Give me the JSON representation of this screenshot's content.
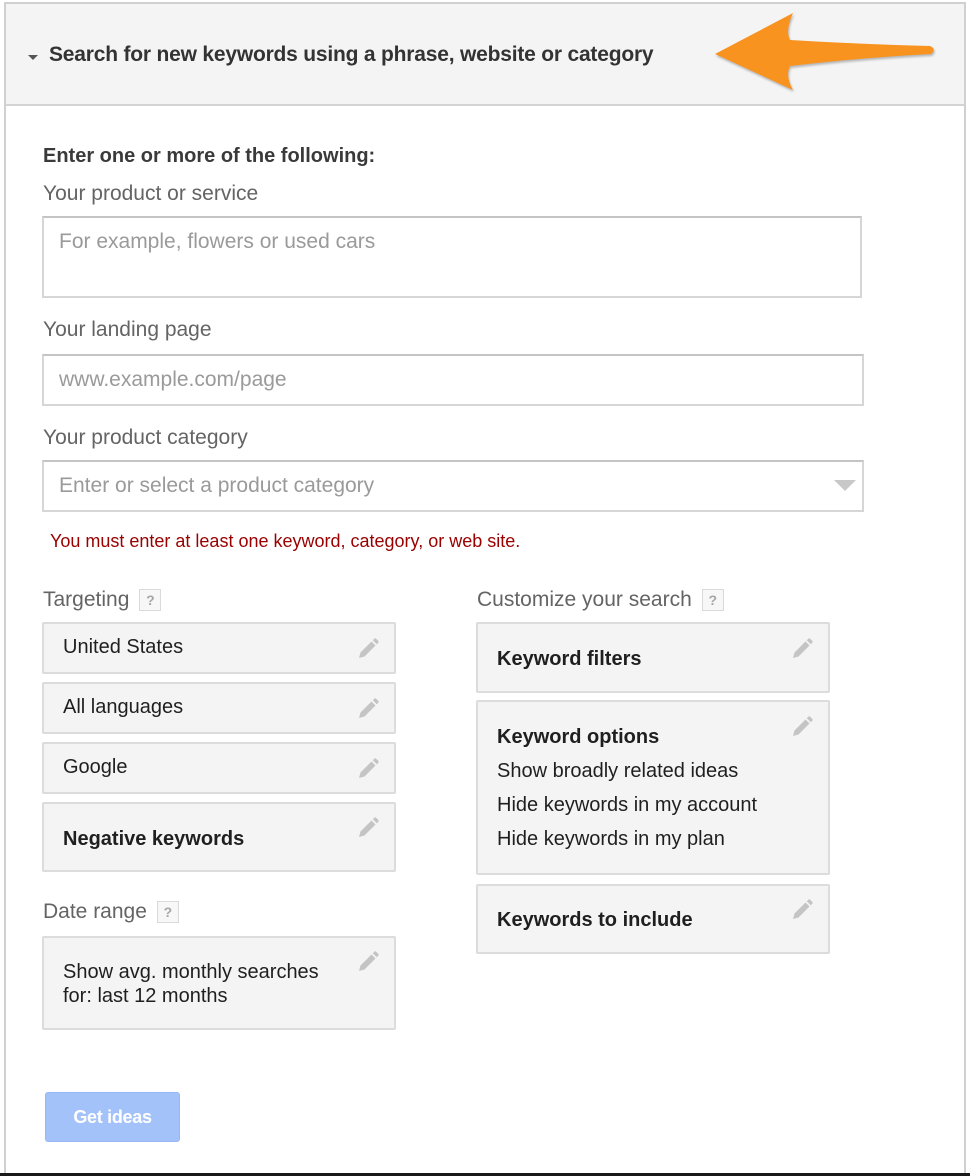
{
  "header": {
    "title": "Search for new keywords using a phrase, website or category",
    "toggle_icon": "triangle-down-icon",
    "annotation": "orange-arrow-pointing-left",
    "annotation_color": "#f7931e"
  },
  "form": {
    "intro": "Enter one or more of the following:",
    "product_service": {
      "label": "Your product or service",
      "value": "",
      "placeholder": "For example, flowers or used cars"
    },
    "landing_page": {
      "label": "Your landing page",
      "value": "",
      "placeholder": "www.example.com/page"
    },
    "product_category": {
      "label": "Your product category",
      "value": "",
      "placeholder": "Enter or select a product category"
    },
    "error": "You must enter at least one keyword, category, or web site.",
    "error_color": "#990000"
  },
  "targeting": {
    "label": "Targeting",
    "help": "?",
    "items": [
      {
        "label": "United States"
      },
      {
        "label": "All languages"
      },
      {
        "label": "Google"
      },
      {
        "label": "Negative keywords"
      }
    ]
  },
  "date_range": {
    "label": "Date range",
    "help": "?",
    "lines": [
      "Show avg. monthly searches",
      "for: last 12 months"
    ]
  },
  "customize": {
    "label": "Customize your search",
    "help": "?",
    "keyword_filters": {
      "title": "Keyword filters"
    },
    "keyword_options": {
      "title": "Keyword options",
      "lines": [
        "Show broadly related ideas",
        "Hide keywords in my account",
        "Hide keywords in my plan"
      ]
    },
    "keywords_to_include": {
      "title": "Keywords to include"
    }
  },
  "actions": {
    "get_ideas": "Get ideas",
    "get_ideas_color": "#a4c2fa"
  }
}
